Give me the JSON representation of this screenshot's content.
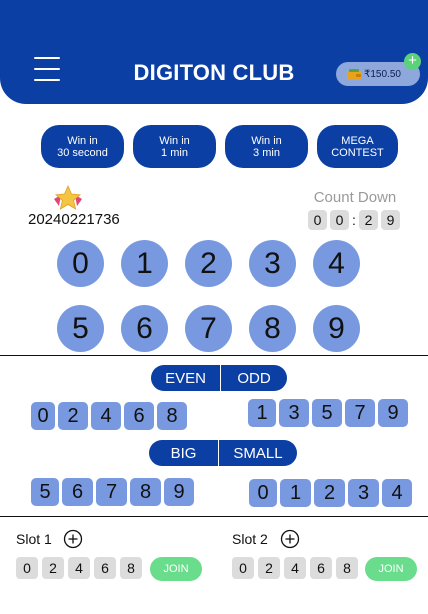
{
  "header": {
    "title": "DIGITON CLUB",
    "wallet_balance": "₹150.50"
  },
  "tabs": [
    {
      "line1": "Win in",
      "line2": "30 second"
    },
    {
      "line1": "Win in",
      "line2": "1 min"
    },
    {
      "line1": "Win in",
      "line2": "3 min"
    },
    {
      "line1": "MEGA",
      "line2": "CONTEST"
    }
  ],
  "round": {
    "period": "20240221736"
  },
  "countdown": {
    "label": "Count Down",
    "digits": [
      "0",
      "0",
      ":",
      "2",
      "9"
    ]
  },
  "numbers": [
    "0",
    "1",
    "2",
    "3",
    "4",
    "5",
    "6",
    "7",
    "8",
    "9"
  ],
  "even_odd": {
    "even_label": "EVEN",
    "odd_label": "ODD",
    "even_digits": [
      "0",
      "2",
      "4",
      "6",
      "8"
    ],
    "odd_digits": [
      "1",
      "3",
      "5",
      "7",
      "9"
    ]
  },
  "big_small": {
    "big_label": "BIG",
    "small_label": "SMALL",
    "big_digits": [
      "5",
      "6",
      "7",
      "8",
      "9"
    ],
    "small_digits": [
      "0",
      "1",
      "2",
      "3",
      "4"
    ]
  },
  "slots": [
    {
      "label": "Slot 1",
      "digits": [
        "0",
        "2",
        "4",
        "6",
        "8"
      ],
      "join_label": "JOIN"
    },
    {
      "label": "Slot 2",
      "digits": [
        "0",
        "2",
        "4",
        "6",
        "8"
      ],
      "join_label": "JOIN"
    }
  ],
  "colors": {
    "primary": "#0b3fa3",
    "ball": "#7898e0",
    "join": "#69dd8c",
    "digit_bg": "#dcdcdc"
  },
  "icons": {
    "menu": "hamburger-menu-icon",
    "wallet": "wallet-icon",
    "add": "plus-circle-icon",
    "star": "star-icon"
  }
}
